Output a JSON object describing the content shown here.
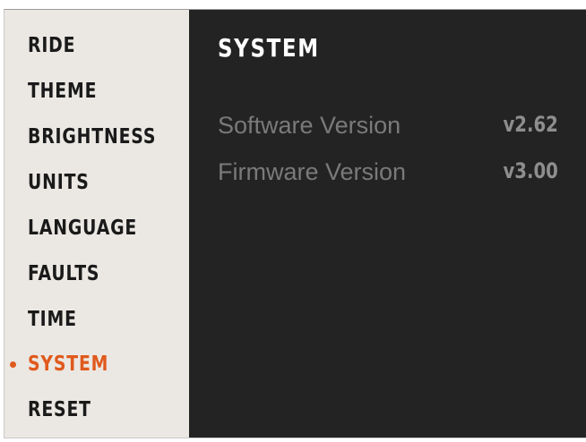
{
  "colors": {
    "sidebar_bg": "#ebe8e3",
    "content_bg": "#232323",
    "accent": "#e05a1d",
    "menu_text": "#1a1a1a",
    "info_text": "#7a7a7a"
  },
  "sidebar": {
    "active_index": 7,
    "items": [
      {
        "label": "RIDE"
      },
      {
        "label": "THEME"
      },
      {
        "label": "BRIGHTNESS"
      },
      {
        "label": "UNITS"
      },
      {
        "label": "LANGUAGE"
      },
      {
        "label": "FAULTS"
      },
      {
        "label": "TIME"
      },
      {
        "label": "SYSTEM"
      },
      {
        "label": "RESET"
      }
    ]
  },
  "main": {
    "title": "SYSTEM",
    "rows": [
      {
        "label": "Software Version",
        "value": "v2.62"
      },
      {
        "label": "Firmware Version",
        "value": "v3.00"
      }
    ]
  }
}
